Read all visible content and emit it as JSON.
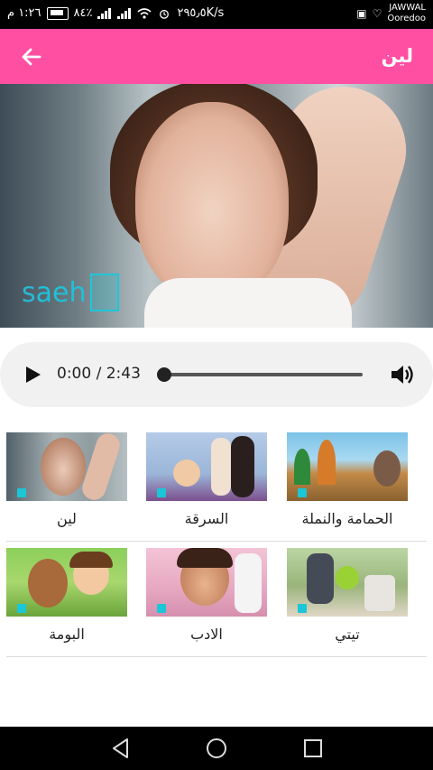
{
  "status_bar": {
    "time": "١:٢٦ م",
    "battery": "٨٤٪",
    "speed": "٢٩٥٫٥K/s",
    "carrier_1": "JAWWAL",
    "carrier_2": "Ooredoo",
    "icons": [
      "battery-icon",
      "signal-icon",
      "wifi-icon",
      "alarm-icon",
      "sim-icon",
      "heart-rate-icon"
    ]
  },
  "app_bar": {
    "title": "لين",
    "back_icon": "arrow-left-icon",
    "color": "#ff4fa3"
  },
  "video": {
    "watermark_letters": "saehH"
  },
  "player": {
    "current_time": "0:00",
    "duration": "2:43",
    "time_display": "0:00 / 2:43",
    "progress": 0.0,
    "icons": [
      "play-icon",
      "volume-icon"
    ]
  },
  "songs": [
    {
      "title": "الحمامة والنملة"
    },
    {
      "title": "السرقة"
    },
    {
      "title": "لين"
    },
    {
      "title": "تيتي"
    },
    {
      "title": "الادب"
    },
    {
      "title": "البومة"
    }
  ],
  "nav_bar": {
    "icons": [
      "back-triangle-icon",
      "home-circle-icon",
      "recents-square-icon"
    ]
  }
}
